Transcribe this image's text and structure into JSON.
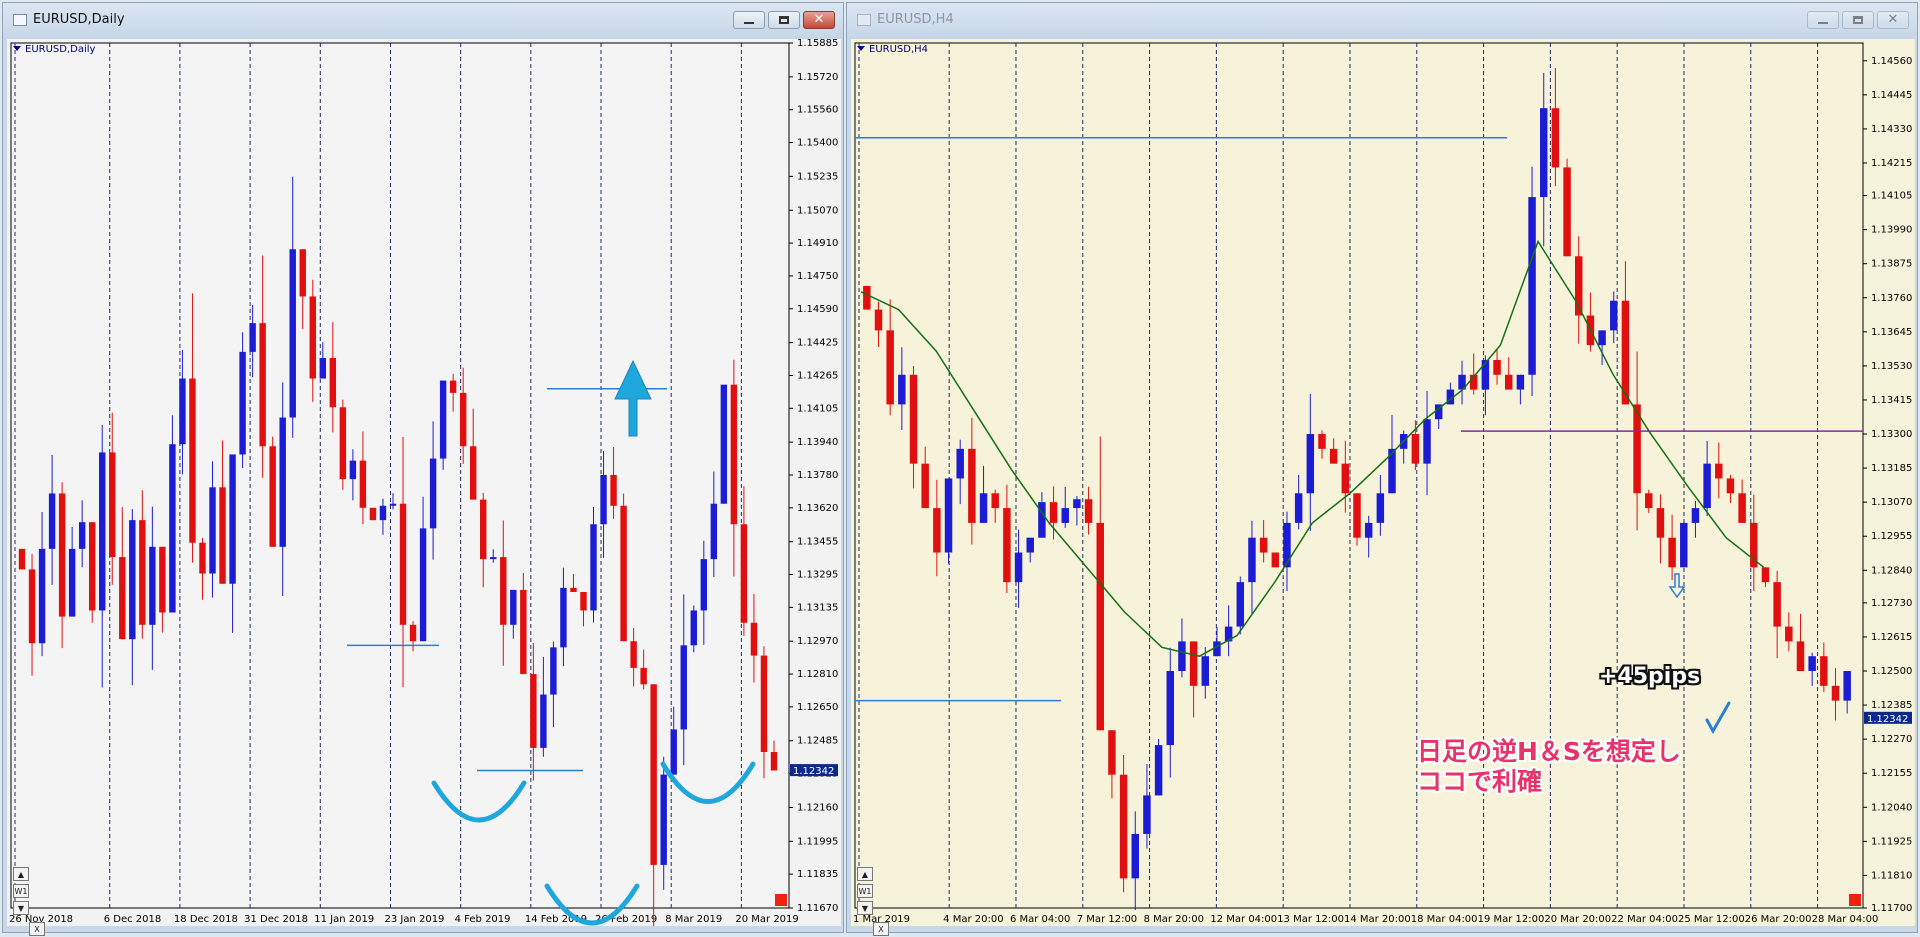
{
  "left_window": {
    "title": "EURUSD,Daily",
    "symbol_label": "EURUSD,Daily",
    "current_price": "1.12342",
    "price_ticks": [
      "1.15885",
      "1.15720",
      "1.15560",
      "1.15400",
      "1.15235",
      "1.15070",
      "1.14910",
      "1.14750",
      "1.14590",
      "1.14425",
      "1.14265",
      "1.14105",
      "1.13940",
      "1.13780",
      "1.13620",
      "1.13455",
      "1.13295",
      "1.13135",
      "1.12970",
      "1.12810",
      "1.12650",
      "1.12485",
      "1.12325",
      "1.12160",
      "1.11995",
      "1.11835",
      "1.11670"
    ],
    "time_ticks": [
      "26 Nov 2018",
      "6 Dec 2018",
      "18 Dec 2018",
      "31 Dec 2018",
      "11 Jan 2019",
      "23 Jan 2019",
      "4 Feb 2019",
      "14 Feb 2019",
      "26 Feb 2019",
      "8 Mar 2019",
      "20 Mar 2019"
    ],
    "period_box": "W1",
    "controls": {
      "up": "▲",
      "down": "▼",
      "close": "X"
    }
  },
  "right_window": {
    "title": "EURUSD,H4",
    "symbol_label": "EURUSD,H4",
    "current_price": "1.12342",
    "price_ticks": [
      "1.14560",
      "1.14445",
      "1.14330",
      "1.14215",
      "1.14105",
      "1.13990",
      "1.13875",
      "1.13760",
      "1.13645",
      "1.13530",
      "1.13415",
      "1.13300",
      "1.13185",
      "1.13070",
      "1.12955",
      "1.12840",
      "1.12730",
      "1.12615",
      "1.12500",
      "1.12385",
      "1.12270",
      "1.12155",
      "1.12040",
      "1.11925",
      "1.11810",
      "1.11700"
    ],
    "time_ticks": [
      "1 Mar 2019",
      "4 Mar 20:00",
      "6 Mar 04:00",
      "7 Mar 12:00",
      "8 Mar 20:00",
      "12 Mar 04:00",
      "13 Mar 12:00",
      "14 Mar 20:00",
      "18 Mar 04:00",
      "19 Mar 12:00",
      "20 Mar 20:00",
      "22 Mar 04:00",
      "25 Mar 12:00",
      "26 Mar 20:00",
      "28 Mar 04:00"
    ],
    "period_box": "W1",
    "controls": {
      "up": "▲",
      "down": "▼",
      "close": "X"
    },
    "annotation_pips": "+45pips",
    "annotation_note_line1": "日足の逆H＆Sを想定し",
    "annotation_note_line2": "ココで利確"
  },
  "colors": {
    "bull": "#1c1cd4",
    "bear": "#e01010",
    "ma": "#157015",
    "level": "#2a7fd0",
    "purple_level": "#8a2a9a",
    "annotation": "#e8336a",
    "cyan_marker": "#1fa6dd",
    "bg_left": "#f2f2f2",
    "bg_right": "#f6f3dc"
  },
  "icons": [
    "chart-window-icon",
    "minimize-icon",
    "maximize-icon",
    "close-icon",
    "up-arrow-icon",
    "checkmark-icon",
    "down-arrow-icon",
    "scroll-up-icon",
    "scroll-down-icon"
  ],
  "chart_data": [
    {
      "type": "candlestick",
      "title": "EURUSD,Daily",
      "ylim": [
        1.1167,
        1.15885
      ],
      "x_labels": [
        "26 Nov 2018",
        "6 Dec 2018",
        "18 Dec 2018",
        "31 Dec 2018",
        "11 Jan 2019",
        "23 Jan 2019",
        "4 Feb 2019",
        "14 Feb 2019",
        "26 Feb 2019",
        "8 Mar 2019",
        "20 Mar 2019"
      ],
      "close_path": [
        1.1332,
        1.1296,
        1.1342,
        1.1369,
        1.1309,
        1.1342,
        1.1355,
        1.1312,
        1.1389,
        1.1338,
        1.1298,
        1.1356,
        1.1305,
        1.1343,
        1.1311,
        1.1393,
        1.1425,
        1.1345,
        1.133,
        1.1372,
        1.1325,
        1.1388,
        1.1438,
        1.1452,
        1.1392,
        1.1343,
        1.1406,
        1.1488,
        1.1465,
        1.1425,
        1.1435,
        1.1411,
        1.1376,
        1.1385,
        1.1362,
        1.1356,
        1.1363,
        1.1364,
        1.1305,
        1.1297,
        1.1352,
        1.1386,
        1.1424,
        1.1418,
        1.1392,
        1.1366,
        1.1337,
        1.1338,
        1.1305,
        1.1322,
        1.1281,
        1.1245,
        1.1271,
        1.1294,
        1.1323,
        1.1321,
        1.1312,
        1.1354,
        1.1378,
        1.1363,
        1.1297,
        1.1284,
        1.1276,
        1.1188,
        1.1232,
        1.1254,
        1.1295,
        1.1312,
        1.1337,
        1.1364,
        1.1422,
        1.1354,
        1.1306,
        1.129,
        1.1243,
        1.1234
      ],
      "levels": [
        1.142,
        1.1295,
        1.1234
      ]
    },
    {
      "type": "candlestick",
      "title": "EURUSD,H4",
      "ylim": [
        1.117,
        1.1462
      ],
      "x_labels": [
        "1 Mar 2019",
        "4 Mar 20:00",
        "6 Mar 04:00",
        "7 Mar 12:00",
        "8 Mar 20:00",
        "12 Mar 04:00",
        "13 Mar 12:00",
        "14 Mar 20:00",
        "18 Mar 04:00",
        "19 Mar 12:00",
        "20 Mar 20:00",
        "22 Mar 04:00",
        "25 Mar 12:00",
        "26 Mar 20:00",
        "28 Mar 04:00"
      ],
      "close_path": [
        1.1372,
        1.1365,
        1.134,
        1.135,
        1.132,
        1.1305,
        1.129,
        1.1315,
        1.1325,
        1.13,
        1.131,
        1.1305,
        1.128,
        1.129,
        1.1295,
        1.1307,
        1.13,
        1.1305,
        1.1308,
        1.13,
        1.123,
        1.1215,
        1.118,
        1.1195,
        1.1208,
        1.1225,
        1.125,
        1.126,
        1.1245,
        1.1255,
        1.126,
        1.1265,
        1.128,
        1.1295,
        1.129,
        1.1285,
        1.13,
        1.131,
        1.133,
        1.1325,
        1.132,
        1.131,
        1.1295,
        1.13,
        1.131,
        1.1325,
        1.133,
        1.132,
        1.1335,
        1.134,
        1.1345,
        1.135,
        1.1345,
        1.1355,
        1.135,
        1.1345,
        1.135,
        1.141,
        1.144,
        1.142,
        1.139,
        1.137,
        1.136,
        1.1365,
        1.1375,
        1.134,
        1.131,
        1.1305,
        1.1295,
        1.1285,
        1.13,
        1.1305,
        1.132,
        1.1315,
        1.131,
        1.13,
        1.1285,
        1.128,
        1.1265,
        1.126,
        1.125,
        1.1255,
        1.1245,
        1.124,
        1.125
      ],
      "moving_average": [
        1.1378,
        1.1372,
        1.1358,
        1.1338,
        1.1318,
        1.13,
        1.1285,
        1.127,
        1.1258,
        1.1255,
        1.1262,
        1.128,
        1.13,
        1.131,
        1.1322,
        1.1335,
        1.1345,
        1.136,
        1.1395,
        1.1375,
        1.135,
        1.133,
        1.1312,
        1.1295,
        1.1285
      ],
      "levels": [
        1.143,
        1.124,
        1.1331
      ]
    }
  ]
}
